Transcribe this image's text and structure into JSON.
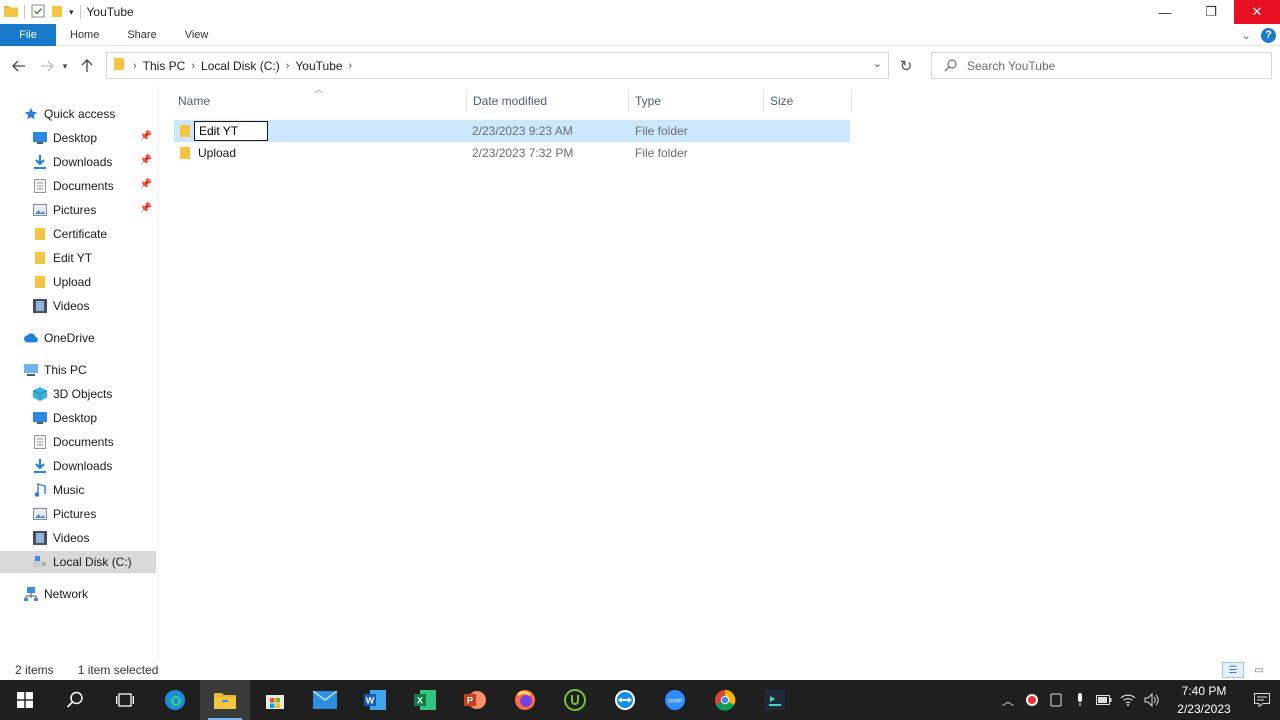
{
  "window": {
    "title": "YouTube",
    "minimize_glyph": "—",
    "restore_glyph": "❐",
    "close_glyph": "✕"
  },
  "ribbon": {
    "tabs": [
      "File",
      "Home",
      "Share",
      "View"
    ],
    "help_label": "?"
  },
  "address": {
    "crumbs": [
      "This PC",
      "Local Disk (C:)",
      "YouTube"
    ]
  },
  "search": {
    "placeholder": "Search YouTube"
  },
  "nav": {
    "quick_access": "Quick access",
    "quick_items": [
      {
        "label": "Desktop",
        "icon": "desktop-icon",
        "pinned": true
      },
      {
        "label": "Downloads",
        "icon": "downloads-icon",
        "pinned": true
      },
      {
        "label": "Documents",
        "icon": "documents-icon",
        "pinned": true
      },
      {
        "label": "Pictures",
        "icon": "pictures-icon",
        "pinned": true
      },
      {
        "label": "Certificate",
        "icon": "folder-icon",
        "pinned": false
      },
      {
        "label": "Edit YT",
        "icon": "folder-icon",
        "pinned": false
      },
      {
        "label": "Upload",
        "icon": "folder-icon",
        "pinned": false
      },
      {
        "label": "Videos",
        "icon": "videos-icon",
        "pinned": false
      }
    ],
    "onedrive": "OneDrive",
    "this_pc": "This PC",
    "pc_items": [
      {
        "label": "3D Objects",
        "icon": "3d-objects-icon"
      },
      {
        "label": "Desktop",
        "icon": "desktop-icon"
      },
      {
        "label": "Documents",
        "icon": "documents-icon"
      },
      {
        "label": "Downloads",
        "icon": "downloads-icon"
      },
      {
        "label": "Music",
        "icon": "music-icon"
      },
      {
        "label": "Pictures",
        "icon": "pictures-icon"
      },
      {
        "label": "Videos",
        "icon": "videos-icon"
      },
      {
        "label": "Local Disk (C:)",
        "icon": "local-disk-icon"
      }
    ],
    "network": "Network"
  },
  "columns": {
    "name": "Name",
    "date": "Date modified",
    "type": "Type",
    "size": "Size"
  },
  "files": [
    {
      "name": "Edit YT",
      "date": "2/23/2023 9:23 AM",
      "type": "File folder",
      "selected": true,
      "renaming": true
    },
    {
      "name": "Upload",
      "date": "2/23/2023 7:32 PM",
      "type": "File folder",
      "selected": false,
      "renaming": false
    }
  ],
  "status": {
    "count": "2 items",
    "selection": "1 item selected"
  },
  "taskbar": {
    "apps": [
      "windows-start-icon",
      "search-icon",
      "task-view-icon",
      "edge-icon",
      "file-explorer-icon",
      "store-icon",
      "mail-icon",
      "word-icon",
      "excel-icon",
      "powerpoint-icon",
      "firefox-icon",
      "utorrent-icon",
      "teamviewer-icon",
      "zoom-icon",
      "chrome-icon",
      "app-icon"
    ],
    "time": "7:40 PM",
    "date": "2/23/2023"
  },
  "colors": {
    "file_tab": "#1979ca",
    "selection": "#cce8ff",
    "close": "#e81123",
    "taskbar": "#1f1f1f",
    "folder": "#f5c542"
  }
}
